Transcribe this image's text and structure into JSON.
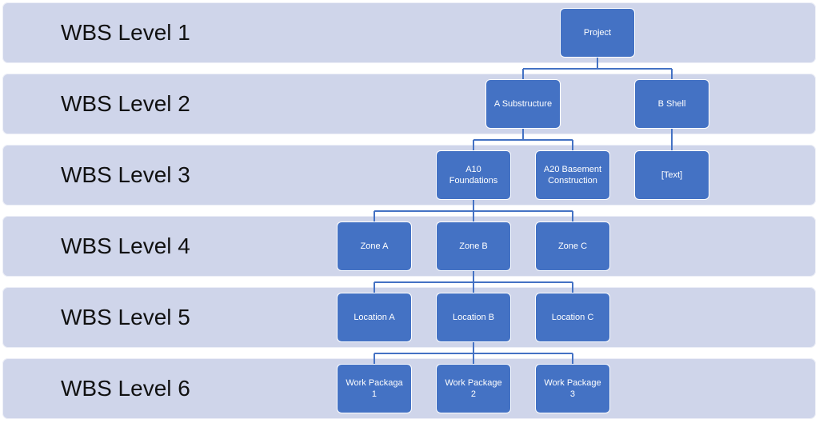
{
  "levels": [
    {
      "label": "WBS Level 1"
    },
    {
      "label": "WBS Level 2"
    },
    {
      "label": "WBS Level 3"
    },
    {
      "label": "WBS Level 4"
    },
    {
      "label": "WBS Level 5"
    },
    {
      "label": "WBS Level 6"
    }
  ],
  "nodes": {
    "project": {
      "label": "Project",
      "level": 1
    },
    "a_substructure": {
      "label": "A Substructure",
      "level": 2,
      "parent": "project"
    },
    "b_shell": {
      "label": "B Shell",
      "level": 2,
      "parent": "project"
    },
    "a10_foundations": {
      "label": "A10\nFoundations",
      "level": 3,
      "parent": "a_substructure"
    },
    "a20_basement": {
      "label": "A20 Basement\nConstruction",
      "level": 3,
      "parent": "a_substructure"
    },
    "text_placeholder": {
      "label": "[Text]",
      "level": 3,
      "parent": "b_shell"
    },
    "zone_a": {
      "label": "Zone A",
      "level": 4,
      "parent": "a10_foundations"
    },
    "zone_b": {
      "label": "Zone B",
      "level": 4,
      "parent": "a10_foundations"
    },
    "zone_c": {
      "label": "Zone C",
      "level": 4,
      "parent": "a10_foundations"
    },
    "location_a": {
      "label": "Location A",
      "level": 5,
      "parent": "zone_b"
    },
    "location_b": {
      "label": "Location B",
      "level": 5,
      "parent": "zone_b"
    },
    "location_c": {
      "label": "Location C",
      "level": 5,
      "parent": "zone_b"
    },
    "work_package_1": {
      "label": "Work Packaga\n1",
      "level": 6,
      "parent": "location_b"
    },
    "work_package_2": {
      "label": "Work Package\n2",
      "level": 6,
      "parent": "location_b"
    },
    "work_package_3": {
      "label": "Work Package\n3",
      "level": 6,
      "parent": "location_b"
    }
  },
  "colors": {
    "band": "#cfd5ea",
    "node": "#4472c4",
    "connector": "#4472c4",
    "label_text": "#111111",
    "node_text": "#ffffff"
  }
}
